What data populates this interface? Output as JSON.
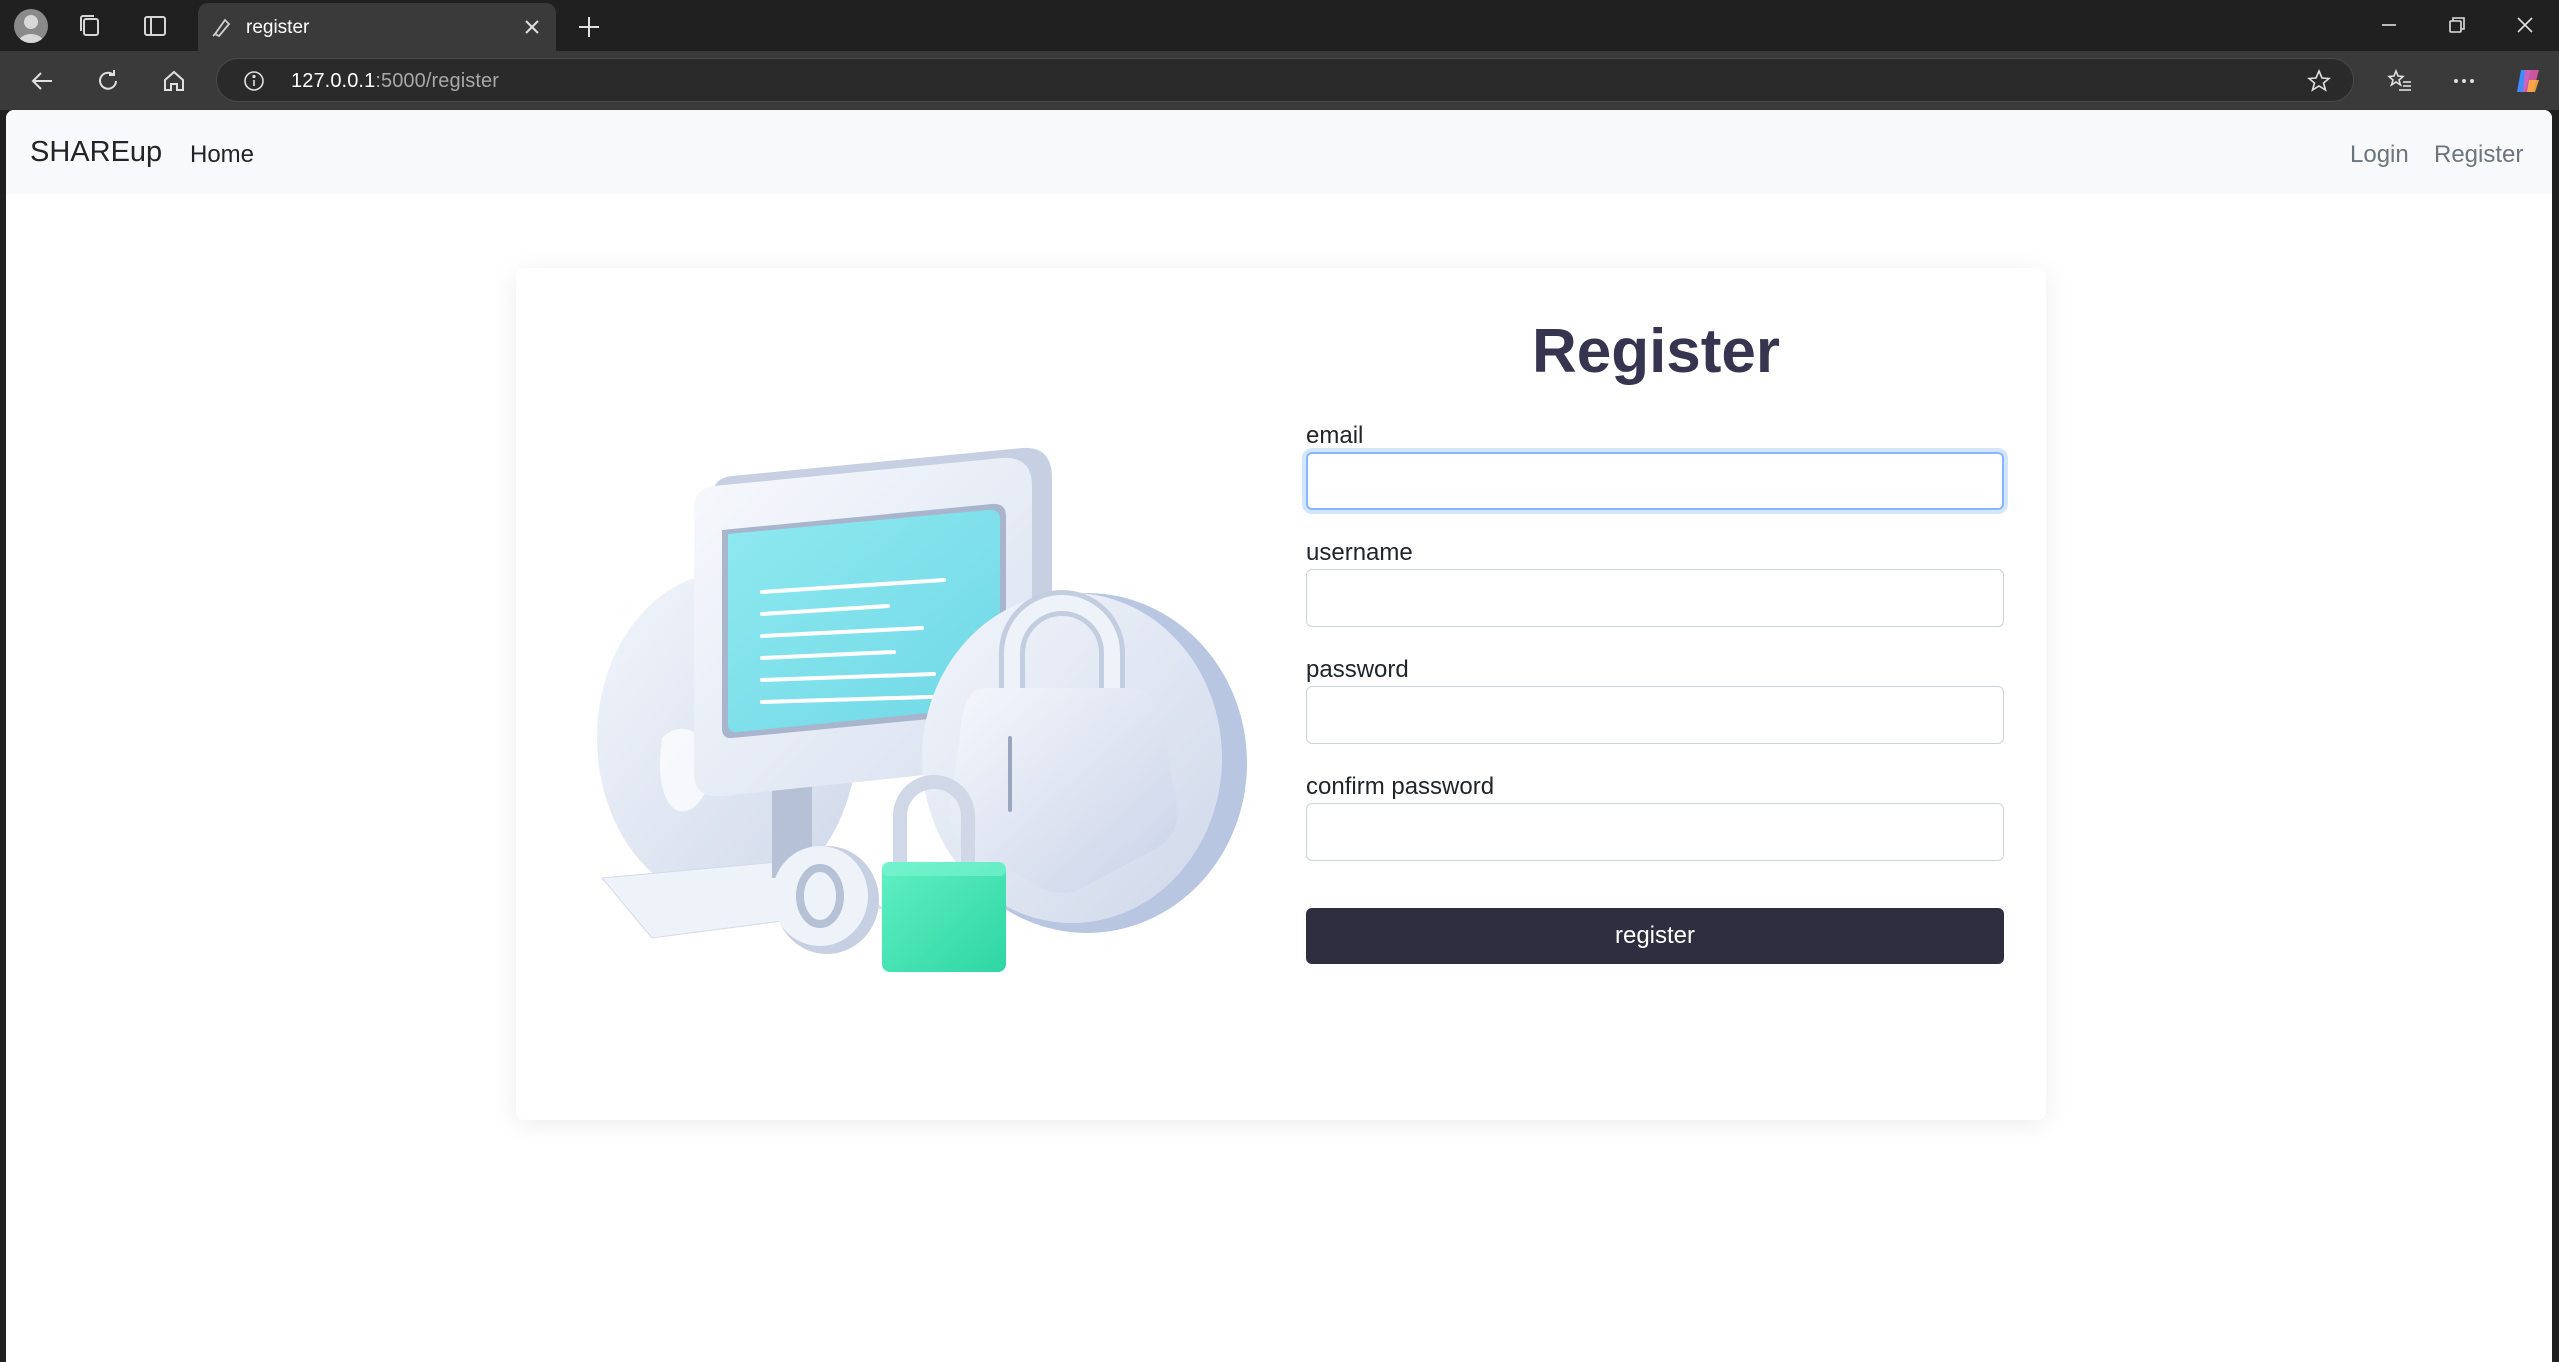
{
  "browser": {
    "tab_title": "register",
    "url_host": "127.0.0.1",
    "url_rest": ":5000/register",
    "icons": [
      "profile-icon",
      "collections-icon",
      "tab-actions-icon",
      "tab-favicon-icon",
      "close-icon",
      "new-tab-icon",
      "minimize-icon",
      "restore-icon",
      "window-close-icon",
      "back-icon",
      "reload-icon",
      "home-icon",
      "site-info-icon",
      "favorite-star-icon",
      "favorites-list-icon",
      "more-icon",
      "copilot-icon"
    ]
  },
  "navbar": {
    "brand": "SHAREup",
    "home": "Home",
    "login": "Login",
    "register": "Register"
  },
  "form": {
    "title": "Register",
    "email_label": "email",
    "email_value": "",
    "username_label": "username",
    "username_value": "",
    "password_label": "password",
    "password_value": "",
    "confirm_label": "confirm password",
    "confirm_value": "",
    "submit_label": "register"
  },
  "colors": {
    "title": "#36344e",
    "button": "#2f2e41",
    "screen_accent": "#7fe3ec",
    "padlock": "#3fe3b4",
    "focus_ring": "#86b7fe"
  }
}
